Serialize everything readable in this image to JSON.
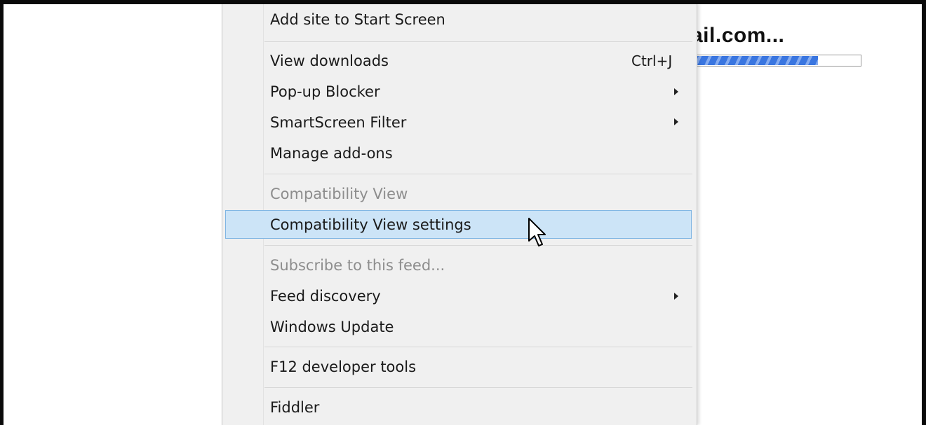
{
  "page": {
    "loading_title": "ail.com...",
    "progress_value": 0.75
  },
  "menu": {
    "items": [
      {
        "label": "Add site to Start Screen",
        "enabled": true,
        "submenu": false
      },
      {
        "label": "View downloads",
        "shortcut": "Ctrl+J",
        "enabled": true,
        "submenu": false
      },
      {
        "label": "Pop-up Blocker",
        "enabled": true,
        "submenu": true
      },
      {
        "label": "SmartScreen Filter",
        "enabled": true,
        "submenu": true
      },
      {
        "label": "Manage add-ons",
        "enabled": true,
        "submenu": false
      },
      {
        "label": "Compatibility View",
        "enabled": false,
        "submenu": false
      },
      {
        "label": "Compatibility View settings",
        "enabled": true,
        "submenu": false,
        "highlighted": true
      },
      {
        "label": "Subscribe to this feed...",
        "enabled": false,
        "submenu": false
      },
      {
        "label": "Feed discovery",
        "enabled": true,
        "submenu": true
      },
      {
        "label": "Windows Update",
        "enabled": true,
        "submenu": false
      },
      {
        "label": "F12 developer tools",
        "enabled": true,
        "submenu": false
      },
      {
        "label": "Fiddler",
        "enabled": true,
        "submenu": false
      }
    ]
  },
  "colors": {
    "highlight_bg": "#cce4f7",
    "highlight_border": "#7fb5e3",
    "menu_bg": "#f0f0f0",
    "disabled_text": "#8d8d8d",
    "progress_fill": "#3a76e0"
  },
  "icons": [
    "submenu-arrow-icon",
    "mouse-pointer-icon"
  ]
}
